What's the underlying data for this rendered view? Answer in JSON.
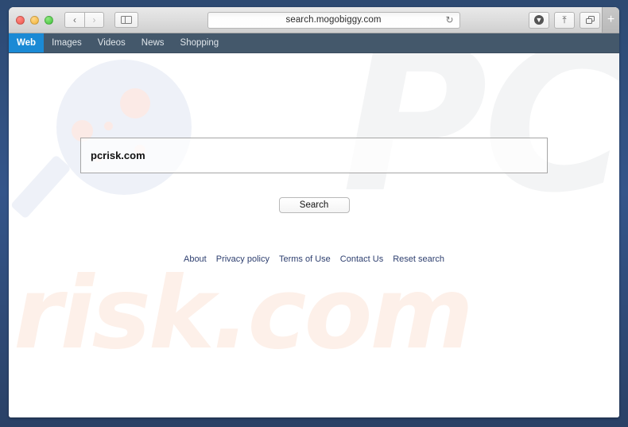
{
  "window": {
    "traffic_lights": [
      "close",
      "minimize",
      "maximize"
    ],
    "back_label": "‹",
    "forward_label": "›",
    "sidebar_tooltip": "Show sidebar",
    "download_label": "⬇",
    "share_label": "↑",
    "new_tab_label": "+"
  },
  "address_bar": {
    "url": "search.mogobiggy.com",
    "reload_label": "↻"
  },
  "site_nav": {
    "items": [
      {
        "label": "Web",
        "active": true
      },
      {
        "label": "Images",
        "active": false
      },
      {
        "label": "Videos",
        "active": false
      },
      {
        "label": "News",
        "active": false
      },
      {
        "label": "Shopping",
        "active": false
      }
    ]
  },
  "search": {
    "query": "pcrisk.com",
    "placeholder": "",
    "button_label": "Search"
  },
  "watermarks": {
    "brand_top": "PC",
    "brand_bottom": "risk.com"
  },
  "footer": {
    "links": [
      {
        "label": "About"
      },
      {
        "label": "Privacy policy"
      },
      {
        "label": "Terms of Use"
      },
      {
        "label": "Contact Us"
      },
      {
        "label": "Reset search"
      }
    ]
  },
  "colors": {
    "frame": "#32537f",
    "nav_bar": "#44586b",
    "active_tab": "#1b8ad5",
    "link": "#2f4070",
    "watermark_grey": "#f3f4f5",
    "watermark_peach": "#fdf0e9",
    "glass_blue": "#eef1f8",
    "glass_dot": "#fbeae6"
  }
}
